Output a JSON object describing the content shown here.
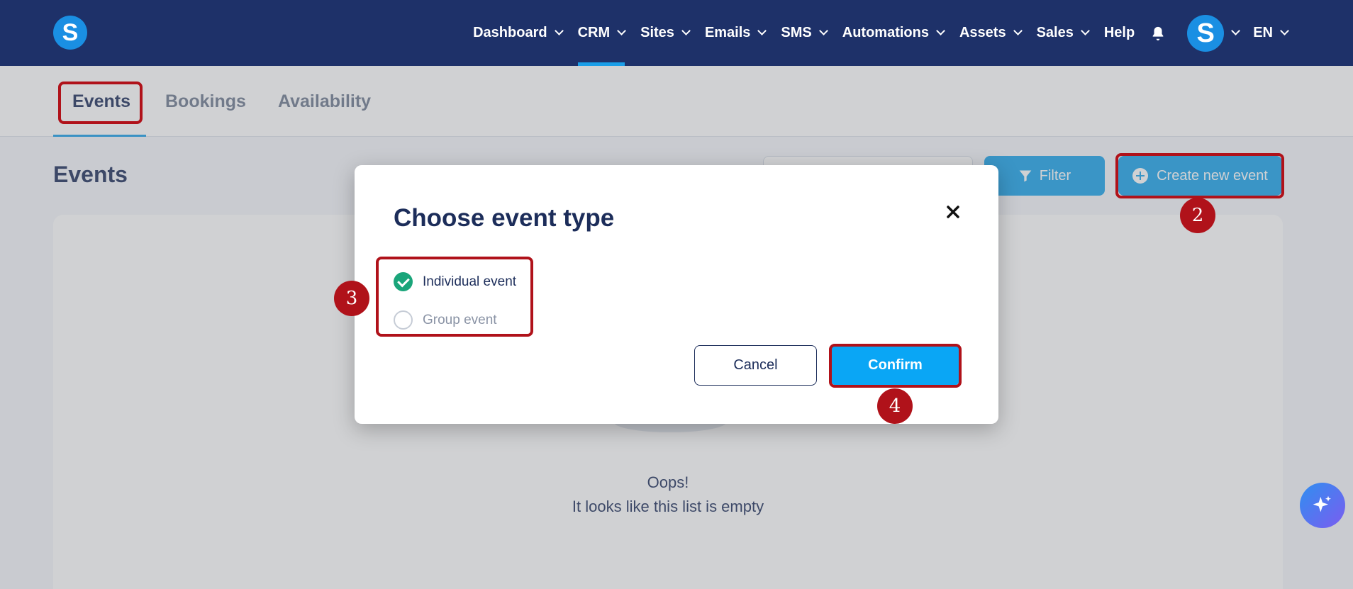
{
  "nav": {
    "logo": "S",
    "items": [
      {
        "label": "Dashboard",
        "dropdown": true
      },
      {
        "label": "CRM",
        "dropdown": true,
        "active": true
      },
      {
        "label": "Sites",
        "dropdown": true
      },
      {
        "label": "Emails",
        "dropdown": true
      },
      {
        "label": "SMS",
        "dropdown": true
      },
      {
        "label": "Automations",
        "dropdown": true
      },
      {
        "label": "Assets",
        "dropdown": true
      },
      {
        "label": "Sales",
        "dropdown": true
      },
      {
        "label": "Help",
        "dropdown": false
      }
    ],
    "avatar": "S",
    "language": "EN"
  },
  "tabs": [
    "Events",
    "Bookings",
    "Availability"
  ],
  "page": {
    "title": "Events",
    "filter_label": "Filter",
    "create_label": "Create new event",
    "empty_line1": "Oops!",
    "empty_line2": "It looks like this list is empty"
  },
  "modal": {
    "title": "Choose event type",
    "options": [
      "Individual event",
      "Group event"
    ],
    "selected": "Individual event",
    "cancel_label": "Cancel",
    "confirm_label": "Confirm"
  },
  "annotations": [
    "2",
    "3",
    "4"
  ],
  "colors": {
    "nav_bg": "#1e3169",
    "accent": "#1aa3ec",
    "annotation": "#b0121a",
    "check": "#1aa57a"
  }
}
